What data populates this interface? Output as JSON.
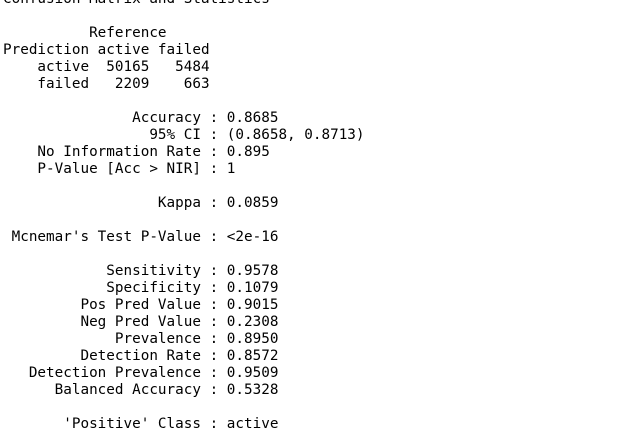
{
  "console": {
    "header": "Confusion Matrix and Statistics",
    "matrix": {
      "reference_label": "          Reference",
      "header_row": "Prediction active failed",
      "rows": [
        "    active  50165   5484",
        "    failed   2209    663"
      ]
    },
    "stats_1": [
      "               Accuracy : 0.8685",
      "                 95% CI : (0.8658, 0.8713)",
      "    No Information Rate : 0.895",
      "    P-Value [Acc > NIR] : 1"
    ],
    "kappa": "                  Kappa : 0.0859",
    "mcnemar": " Mcnemar's Test P-Value : <2e-16",
    "stats_2": [
      "            Sensitivity : 0.9578",
      "            Specificity : 0.1079",
      "         Pos Pred Value : 0.9015",
      "         Neg Pred Value : 0.2308",
      "             Prevalence : 0.8950",
      "         Detection Rate : 0.8572",
      "   Detection Prevalence : 0.9509",
      "      Balanced Accuracy : 0.5328"
    ],
    "positive_class": "       'Positive' Class : active"
  }
}
